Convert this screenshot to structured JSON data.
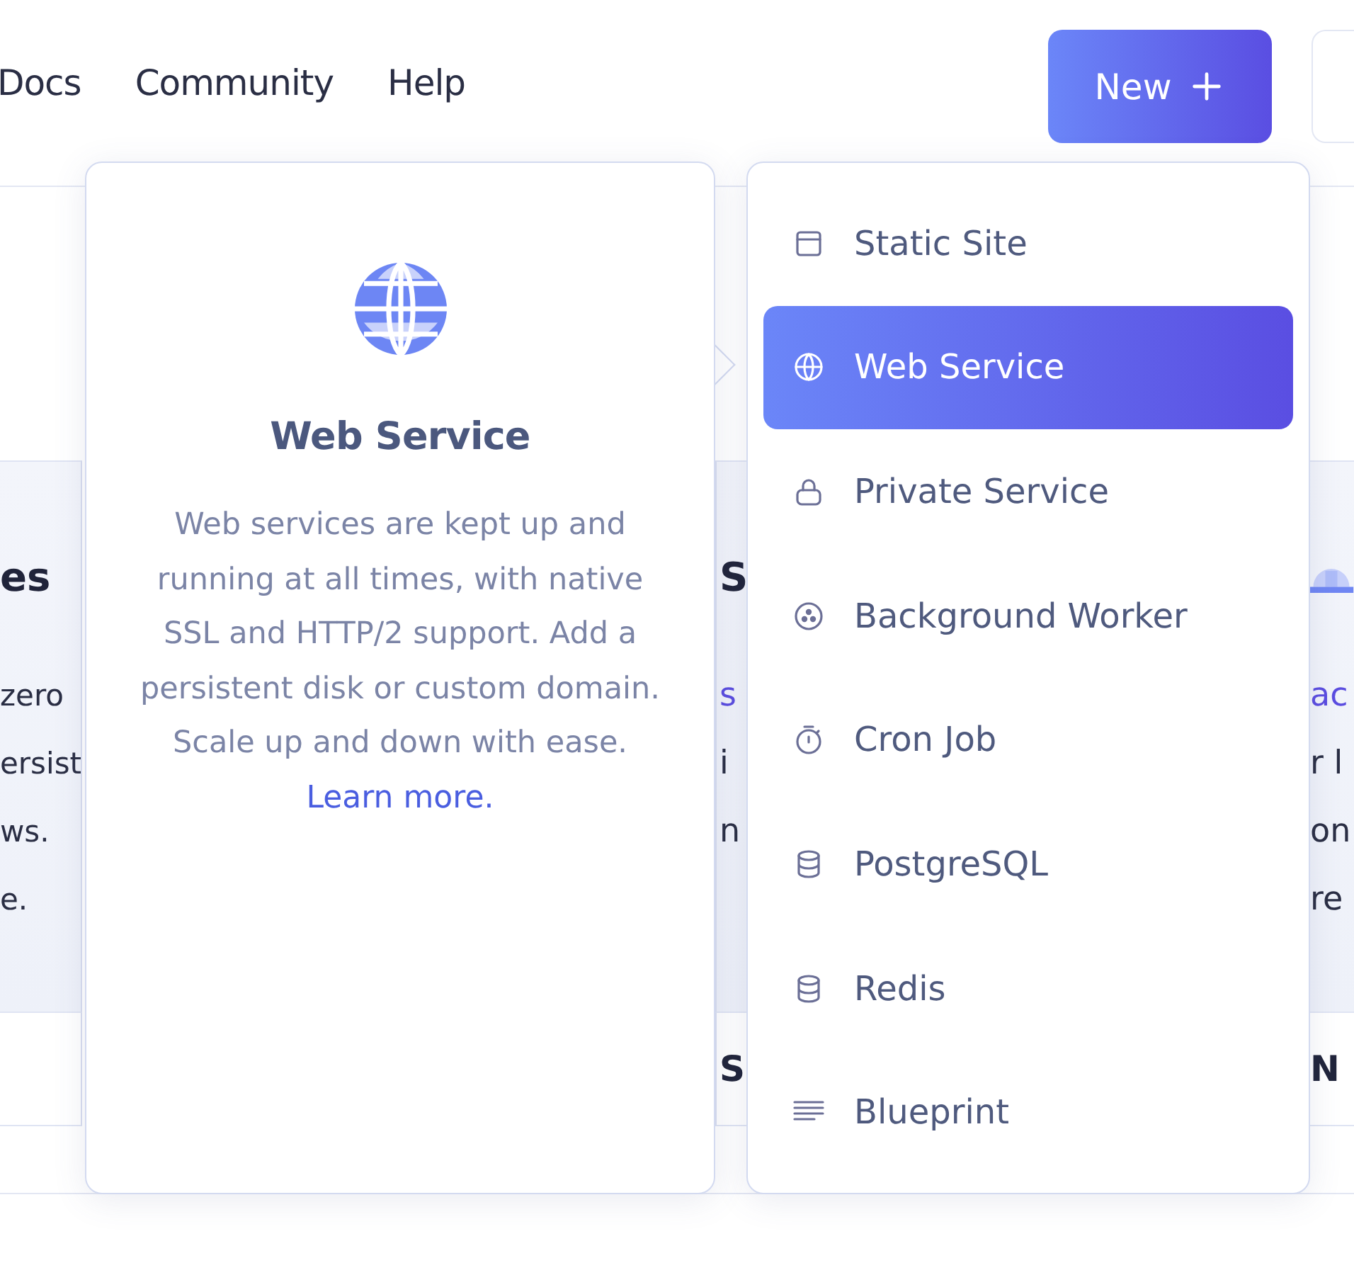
{
  "nav": [
    {
      "label": "Docs"
    },
    {
      "label": "Community"
    },
    {
      "label": "Help"
    }
  ],
  "new_button": {
    "label": "New"
  },
  "background": {
    "left_card": {
      "heading": "es",
      "lines": [
        "zero",
        "ersist",
        "ws.",
        "e."
      ]
    },
    "middle_card": {
      "heading": "S",
      "link": "s",
      "lines": [
        "i",
        "n"
      ],
      "footer": "S"
    },
    "right_card": {
      "link": "ac",
      "lines": [
        "r l",
        "on",
        "re"
      ],
      "footer": "N"
    }
  },
  "preview": {
    "title": "Web Service",
    "description": "Web services are kept up and running at all times, with native SSL and HTTP/2 support. Add a persistent disk or custom domain. Scale up and down with ease.",
    "link": "Learn more."
  },
  "menu": [
    {
      "label": "Static Site",
      "kind": "window",
      "selected": false
    },
    {
      "label": "Web Service",
      "kind": "globe",
      "selected": true
    },
    {
      "label": "Private Service",
      "kind": "lock",
      "selected": false
    },
    {
      "label": "Background Worker",
      "kind": "dots",
      "selected": false
    },
    {
      "label": "Cron Job",
      "kind": "stopwatch",
      "selected": false
    },
    {
      "label": "PostgreSQL",
      "kind": "database",
      "selected": false
    },
    {
      "label": "Redis",
      "kind": "database",
      "selected": false
    },
    {
      "label": "Blueprint",
      "kind": "lines",
      "selected": false
    }
  ]
}
